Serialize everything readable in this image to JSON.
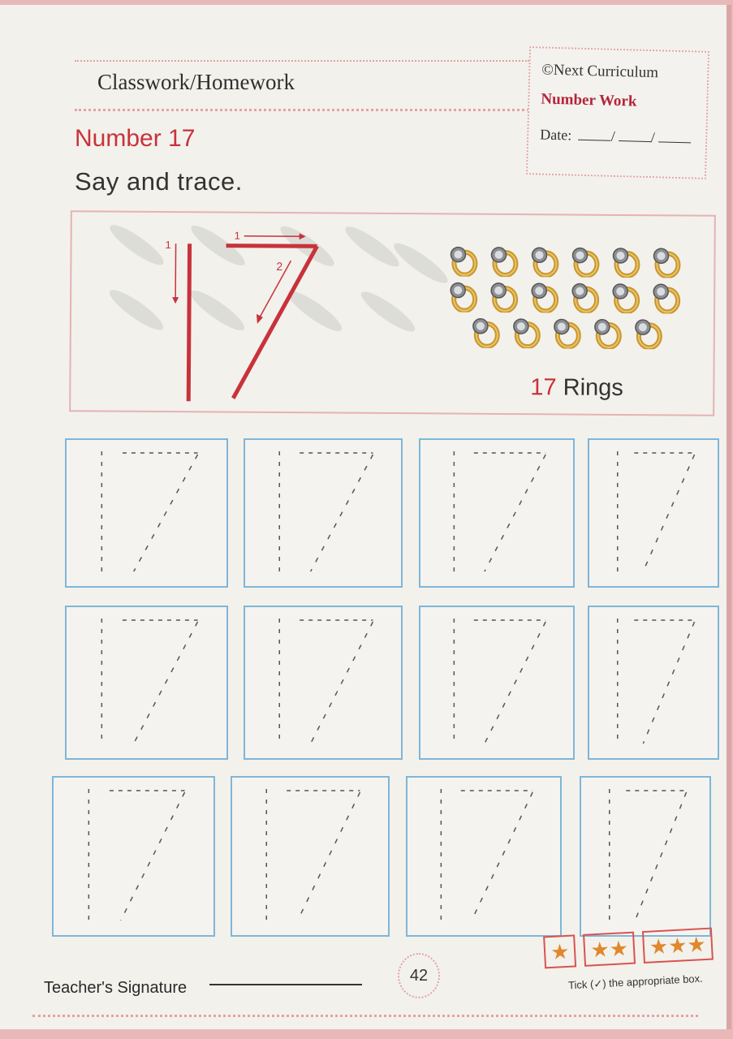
{
  "header": {
    "title": "Classwork/Homework"
  },
  "info": {
    "copyright": "©Next Curriculum",
    "subject": "Number Work",
    "date_label": "Date:",
    "date_sep": "/"
  },
  "lesson": {
    "title": "Number 17",
    "instruction": "Say and trace."
  },
  "demo": {
    "digit_text": "17",
    "stroke_one": "1",
    "stroke_two": "2",
    "ring_count": 17,
    "rings_number": "17",
    "rings_word": "Rings"
  },
  "trace": {
    "digit": "17",
    "rows": 3,
    "columns": 4
  },
  "footer": {
    "teacher_signature": "Teacher's Signature",
    "page_number": "42",
    "stars": [
      "★",
      "★★",
      "★★★"
    ],
    "tick_note": "Tick (✓) the appropriate box."
  },
  "colors": {
    "accent_red": "#c8323b",
    "trace_border": "#7fb6d8",
    "star_color": "#e0882d"
  }
}
